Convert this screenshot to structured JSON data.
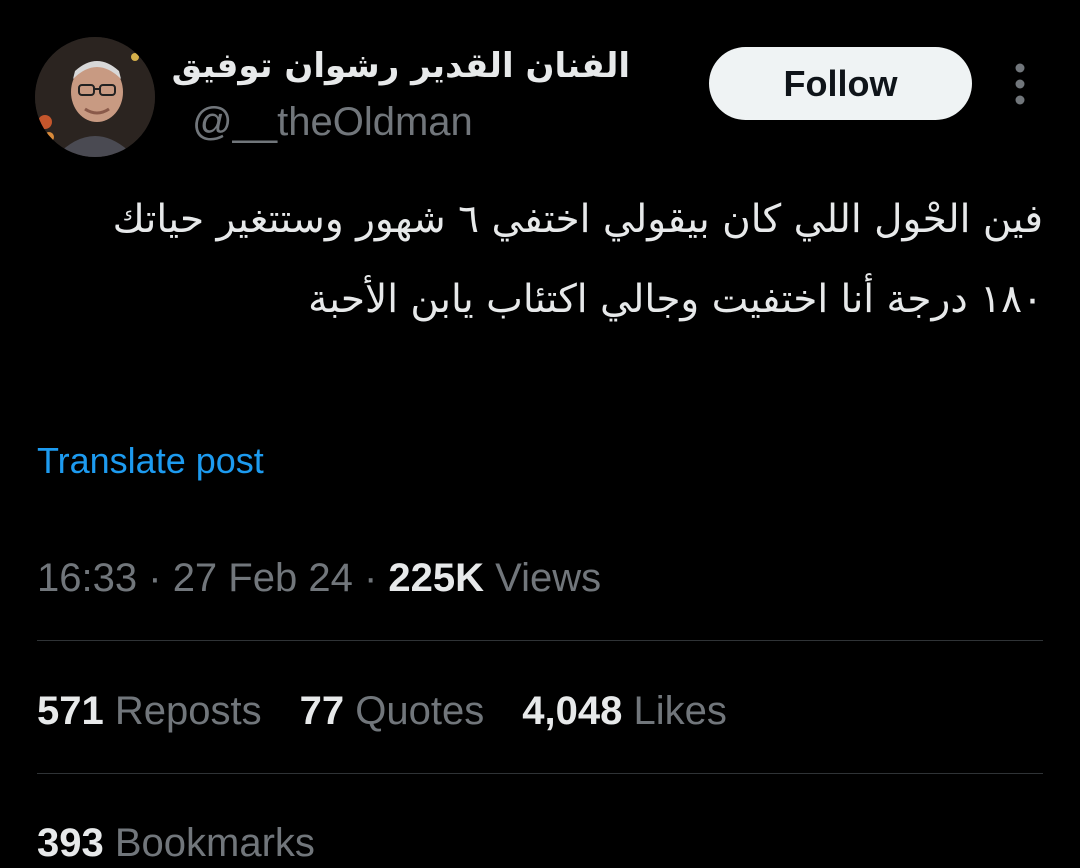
{
  "author": {
    "display_name": "الفنان القدير رشوان توفيق",
    "handle": "@__theOldman",
    "avatar_icon": "profile-photo-elderly-man-with-glasses"
  },
  "header": {
    "follow_label": "Follow",
    "more_icon": "vertical-ellipsis-icon"
  },
  "tweet": {
    "text": "فين الحْول اللي كان بيقولي اختفي ٦ شهور وستتغير حياتك ١٨٠ درجة أنا اختفيت وجالي اكتئاب يابن الأحبة",
    "translate_label": "Translate post"
  },
  "meta": {
    "time": "16:33",
    "separator": "·",
    "date": "27 Feb 24",
    "views_count": "225K",
    "views_label": "Views"
  },
  "stats": {
    "reposts_count": "571",
    "reposts_label": "Reposts",
    "quotes_count": "77",
    "quotes_label": "Quotes",
    "likes_count": "4,048",
    "likes_label": "Likes",
    "bookmarks_count": "393",
    "bookmarks_label": "Bookmarks"
  },
  "colors": {
    "background": "#000000",
    "text_primary": "#e7e9ea",
    "text_secondary": "#71767b",
    "link": "#1d9bf0",
    "follow_bg": "#eff3f4",
    "divider": "#2f3336"
  }
}
